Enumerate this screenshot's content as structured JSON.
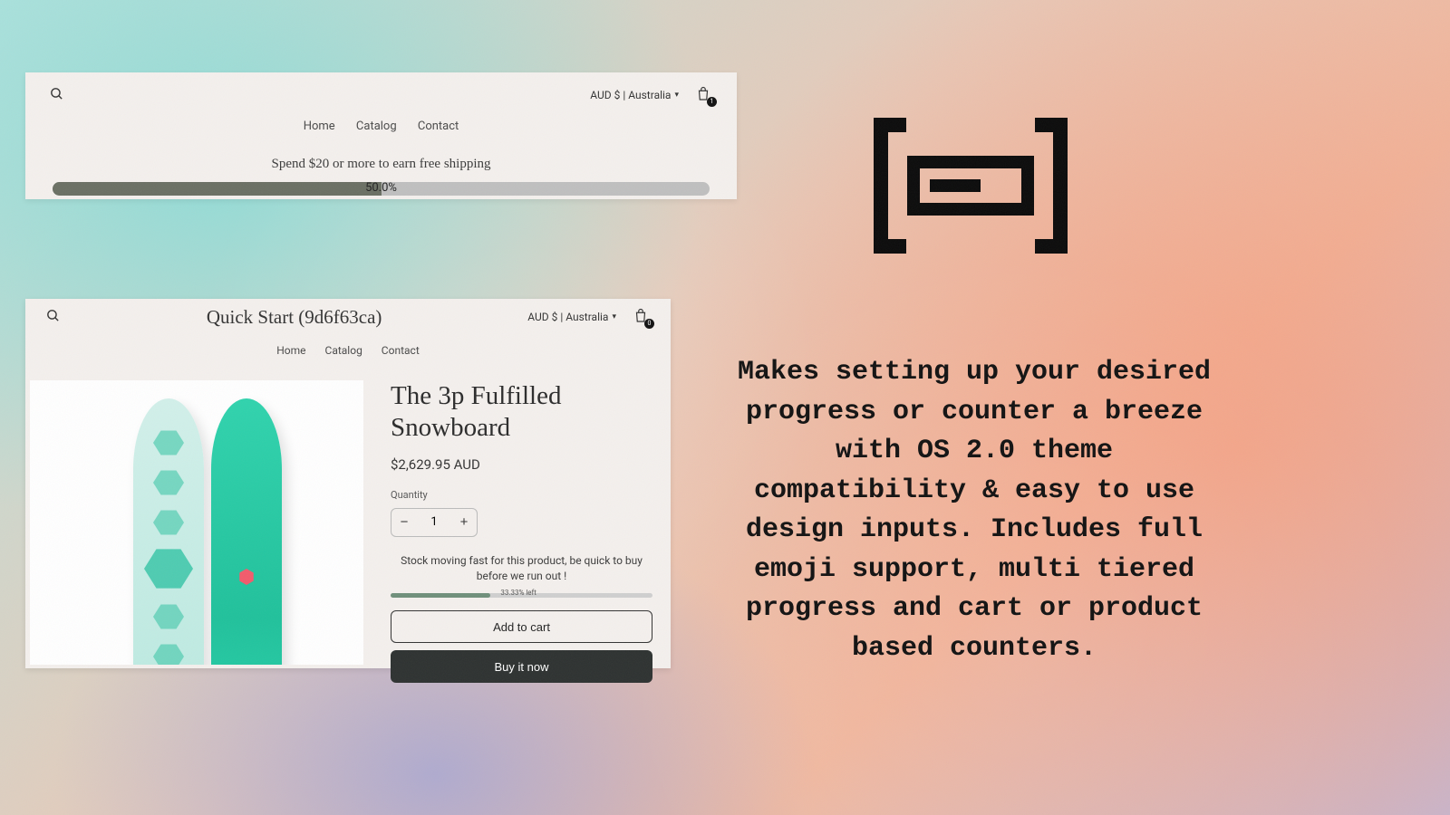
{
  "shot1": {
    "locale": "AUD $ | Australia",
    "cart_count": "1",
    "nav": [
      "Home",
      "Catalog",
      "Contact"
    ],
    "promo": "Spend $20 or more to earn free shipping",
    "progress_label": "50.0%"
  },
  "shot2": {
    "store_name": "Quick Start (9d6f63ca)",
    "locale": "AUD $ | Australia",
    "cart_count": "0",
    "nav": [
      "Home",
      "Catalog",
      "Contact"
    ],
    "product": {
      "title": "The 3p Fulfilled Snowboard",
      "price": "$2,629.95 AUD",
      "qty_label": "Quantity",
      "qty_value": "1",
      "stock_msg": "Stock moving fast for this product, be quick to buy before we run out !",
      "stock_label": "33.33% left",
      "add_label": "Add to cart",
      "buy_label": "Buy it now"
    }
  },
  "marketing_text": "Makes setting up your desired progress or counter a breeze with OS 2.0 theme compatibility & easy to use design inputs. Includes full emoji support, multi tiered progress and cart or product based counters."
}
